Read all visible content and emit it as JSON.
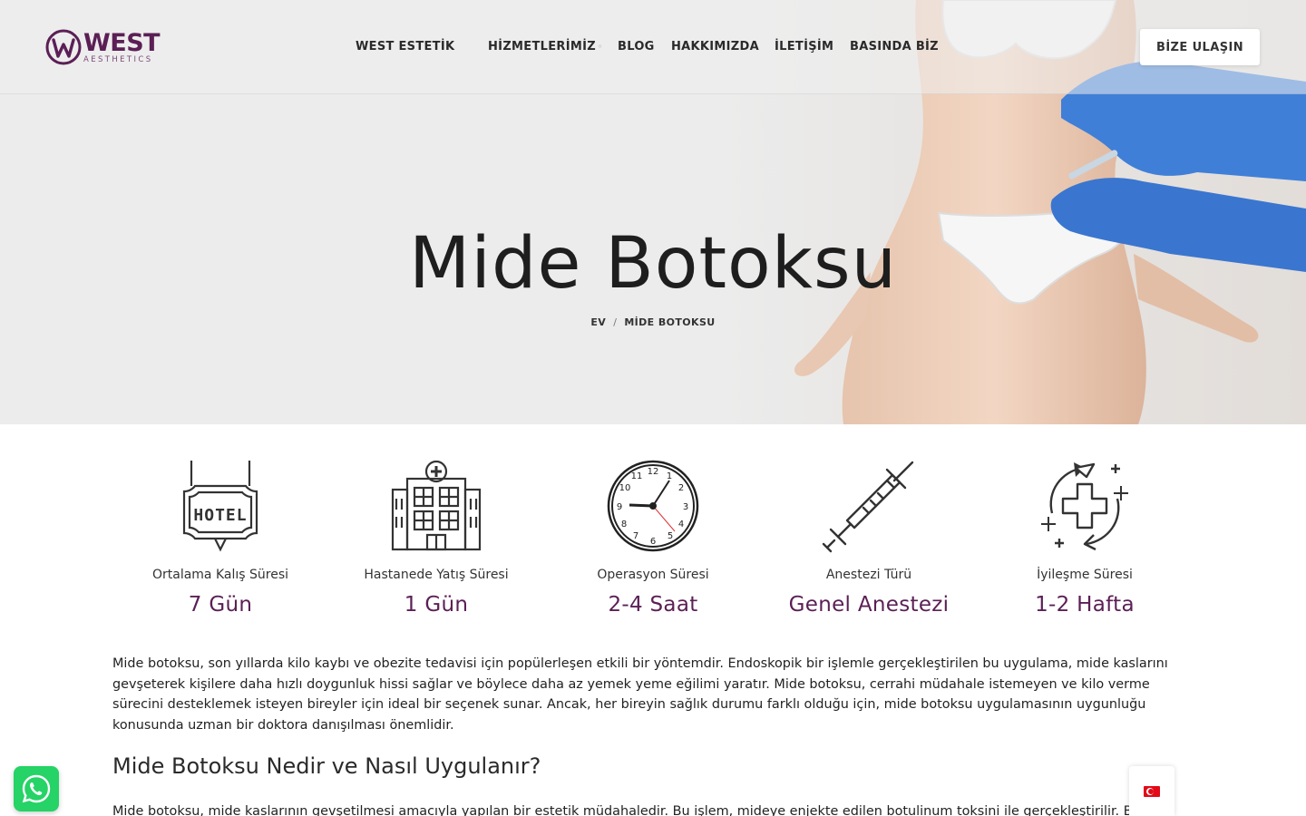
{
  "brand": {
    "name": "WEST",
    "sub": "AESTHETICS"
  },
  "nav": {
    "items": [
      {
        "label": "WEST ESTETİK",
        "has_dropdown": false
      },
      {
        "label": "HİZMETLERİMİZ",
        "has_dropdown": true
      },
      {
        "label": "BLOG",
        "has_dropdown": false
      },
      {
        "label": "HAKKIMIZDA",
        "has_dropdown": false
      },
      {
        "label": "İLETİŞİM",
        "has_dropdown": false
      },
      {
        "label": "BASINDA BİZ",
        "has_dropdown": false
      }
    ],
    "cta_label": "BİZE ULAŞIN"
  },
  "hero": {
    "title": "Mide Botoksu",
    "breadcrumb": {
      "home": "EV",
      "separator": "/",
      "current": "MİDE BOTOKSU"
    }
  },
  "stats": [
    {
      "icon": "hotel-sign-icon",
      "label": "Ortalama Kalış Süresi",
      "value": "7 Gün"
    },
    {
      "icon": "hospital-icon",
      "label": "Hastanede Yatış Süresi",
      "value": "1 Gün"
    },
    {
      "icon": "clock-icon",
      "label": "Operasyon Süresi",
      "value": "2-4 Saat"
    },
    {
      "icon": "syringe-icon",
      "label": "Anestezi Türü",
      "value": "Genel Anestezi"
    },
    {
      "icon": "recovery-cross-icon",
      "label": "İyileşme Süresi",
      "value": "1-2 Hafta"
    }
  ],
  "content": {
    "intro": "Mide botoksu, son yıllarda kilo kaybı ve obezite tedavisi için popülerleşen etkili bir yöntemdir. Endoskopik bir işlemle gerçekleştirilen bu uygulama, mide kaslarını gevşeterek kişilere daha hızlı doygunluk hissi sağlar ve böylece daha az yemek yeme eğilimi yaratır. Mide botoksu, cerrahi müdahale istemeyen ve kilo verme sürecini desteklemek isteyen bireyler için ideal bir seçenek sunar. Ancak, her bireyin sağlık durumu farklı olduğu için, mide botoksu uygulamasının uygunluğu konusunda uzman bir doktora danışılması önemlidir.",
    "heading": "Mide Botoksu Nedir ve Nasıl Uygulanır?",
    "para2": "Mide botoksu, mide kaslarının gevşetilmesi amacıyla yapılan bir estetik müdahaledir. Bu işlem, mideye enjekte edilen botulinum toksini ile gerçekleştirilir. Botoks"
  },
  "colors": {
    "accent": "#5b1f55",
    "whatsapp": "#25d366"
  },
  "widgets": {
    "whatsapp_icon": "whatsapp-icon",
    "language_flag": "turkey-flag-icon"
  }
}
